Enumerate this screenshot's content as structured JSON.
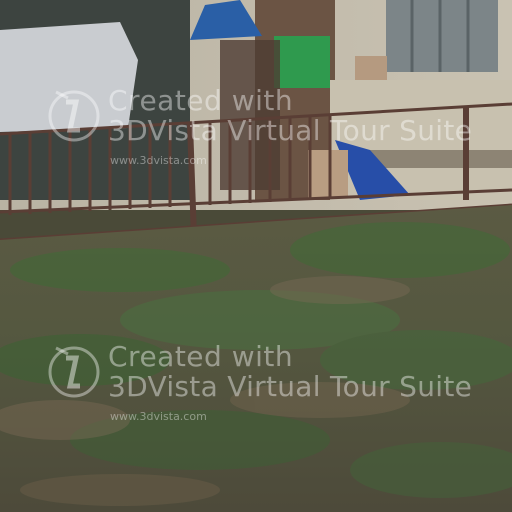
{
  "watermarks": [
    {
      "line1": "Created with",
      "line2": "3DVista Virtual Tour Suite",
      "url": "www.3dvista.com"
    },
    {
      "line1": "Created with",
      "line2": "3DVista Virtual Tour Suite",
      "url": "www.3dvista.com"
    }
  ],
  "icons": {
    "watermark_logo": "3dvista-logo-icon"
  }
}
